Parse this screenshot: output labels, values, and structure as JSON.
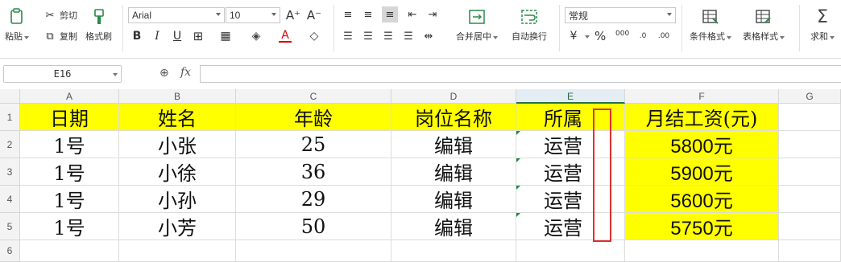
{
  "ribbon": {
    "paste": "粘贴",
    "cut": "剪切",
    "copy": "复制",
    "format_painter": "格式刷",
    "font_name": "Arial",
    "font_size": "10",
    "merge_center": "合并居中",
    "wrap_text": "自动换行",
    "number_format": "常规",
    "conditional_format": "条件格式",
    "table_style": "表格样式",
    "sum": "求和",
    "percent": "%",
    "thousands": "000"
  },
  "formula_bar": {
    "name_box": "E16",
    "fx": "fx",
    "formula": ""
  },
  "columns": [
    "A",
    "B",
    "C",
    "D",
    "E",
    "F",
    "G"
  ],
  "rows": [
    "1",
    "2",
    "3",
    "4",
    "5",
    "6"
  ],
  "table": {
    "headers": [
      "日期",
      "姓名",
      "年龄",
      "岗位名称",
      "所属",
      "月结工资(元)"
    ],
    "data": [
      [
        "1号",
        "小张",
        "25",
        "编辑",
        "运营",
        "5800元"
      ],
      [
        "1号",
        "小徐",
        "36",
        "编辑",
        "运营",
        "5900元"
      ],
      [
        "1号",
        "小孙",
        "29",
        "编辑",
        "运营",
        "5600元"
      ],
      [
        "1号",
        "小芳",
        "50",
        "编辑",
        "运营",
        "5750元"
      ]
    ]
  },
  "colors": {
    "header_fill": "#ffff00",
    "salary_fill": "#ffff00",
    "highlight_box": "#e03030",
    "selected_column_accent": "#217346"
  }
}
